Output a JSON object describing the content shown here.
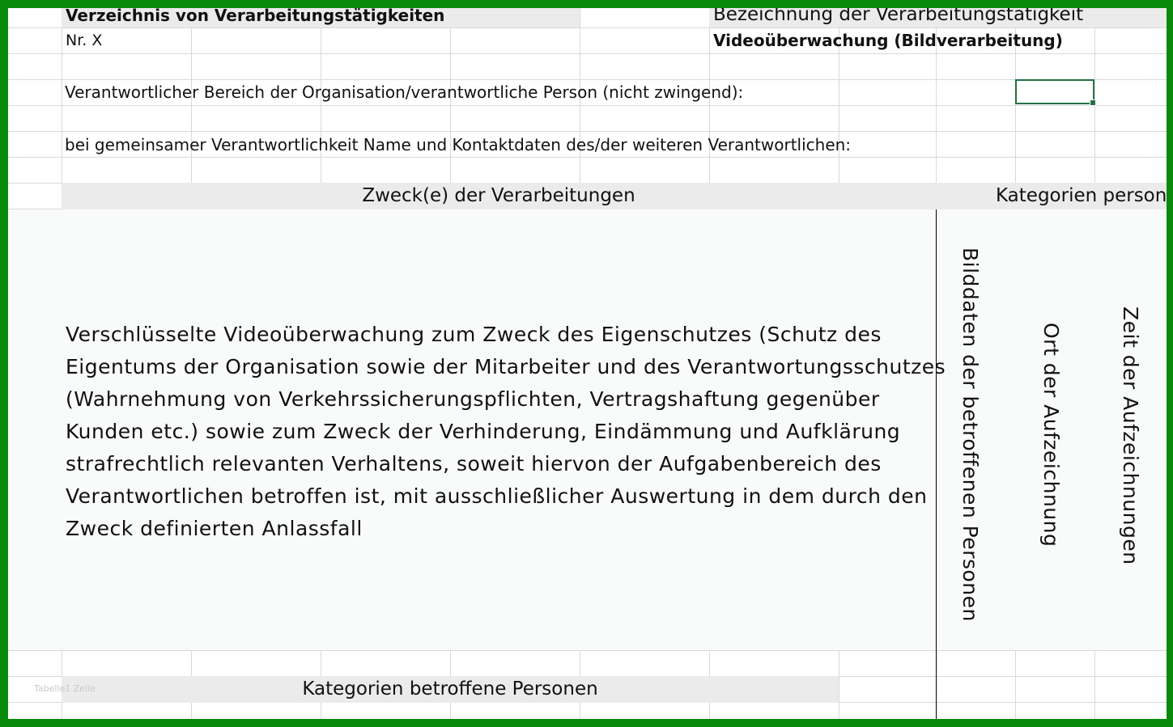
{
  "header": {
    "title_left": "Verzeichnis von Verarbeitungstätigkeiten",
    "number": "Nr. X",
    "title_right": "Bezeichnung der Verarbeitungstätigkeit",
    "activity_name": "Videoüberwachung (Bildverarbeitung)"
  },
  "rows": {
    "responsible_area": "Verantwortlicher Bereich der Organisation/verantwortliche Person (nicht zwingend):",
    "joint_responsibility": "bei gemeinsamer Verantwortlichkeit Name und Kontaktdaten des/der weiteren Verantwortlichen:"
  },
  "sections": {
    "purpose_header": "Zweck(e) der Verarbeitungen",
    "categories_header": "Kategorien person",
    "purpose_text": [
      "Verschlüsselte Videoüberwachung zum Zweck des Eigenschutzes (Schutz des",
      "Eigentums der Organisation sowie der Mitarbeiter und des Verantwortungsschutzes",
      "(Wahrnehmung von Verkehrssicherungspflichten, Vertragshaftung gegenüber",
      "Kunden etc.) sowie zum Zweck der Verhinderung, Eindämmung und Aufklärung",
      "strafrechtlich relevanten Verhaltens, soweit hiervon der Aufgabenbereich des",
      "Verantwortlichen betroffen ist, mit ausschließlicher Auswertung in dem durch den",
      "Zweck definierten Anlassfall"
    ],
    "vertical_labels": [
      "Bilddaten der betroffenen Personen",
      "Ort der Aufzeichnung",
      "Zeit der Aufzeichnungen"
    ],
    "affected_persons_header": "Kategorien betroffene Personen"
  },
  "sheet_tab": "Tabelle1 Zeile",
  "colors": {
    "frame": "#0a8a0a",
    "band": "#ebebeb",
    "merged_fill": "#f9fafa",
    "selection": "#217346"
  }
}
